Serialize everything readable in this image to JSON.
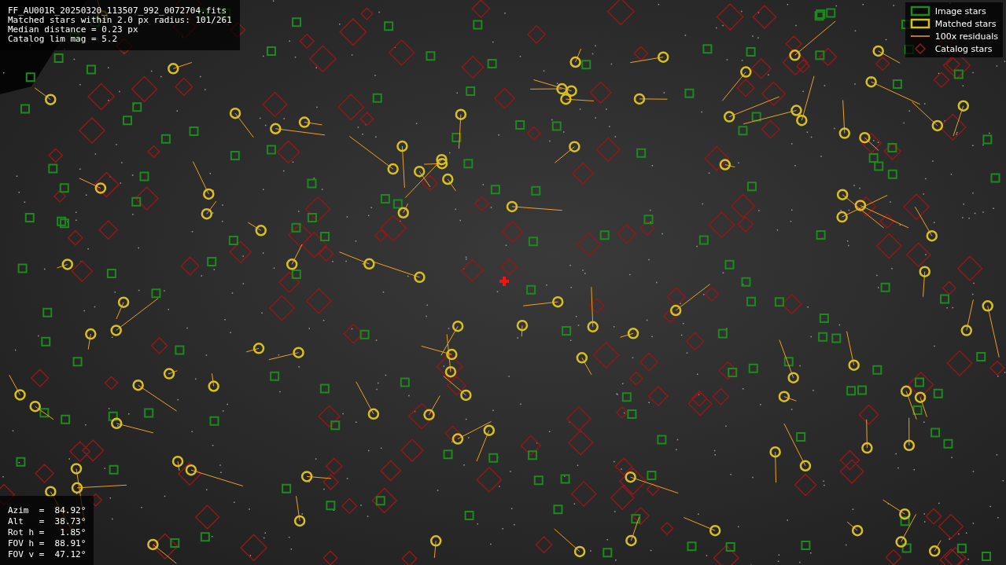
{
  "info_lines": [
    "FF_AU001R_20250320_113507_992_0072704.fits",
    "Matched stars within 2.0 px radius: 101/261",
    "Median distance = 0.23 px",
    "Catalog lim mag = 5.2"
  ],
  "legend": [
    {
      "label": "Image stars"
    },
    {
      "kind": "matched",
      "label": "Matched stars"
    },
    {
      "kind": "residual",
      "label": "100x residuals"
    },
    {
      "kind": "catalog",
      "label": "Catalog stars"
    }
  ],
  "pointing": [
    "Azim  =  84.92°",
    "Alt   =  38.73°",
    "Rot h =   1.85°",
    "FOV h =  88.91°",
    "FOV v =  47.12°"
  ]
}
